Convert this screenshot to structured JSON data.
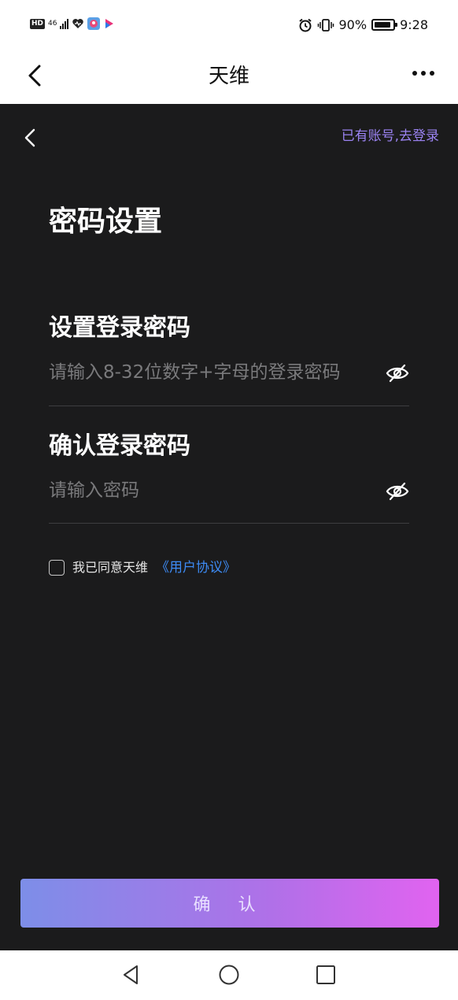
{
  "status_bar": {
    "hd": "HD",
    "network": "46",
    "battery": "90%",
    "battery_level": 0.9,
    "time": "9:28"
  },
  "title_bar": {
    "title": "天维"
  },
  "header": {
    "login_link": "已有账号,去登录"
  },
  "page_title": "密码设置",
  "fields": [
    {
      "label": "设置登录密码",
      "placeholder": "请输入8-32位数字+字母的登录密码",
      "value": ""
    },
    {
      "label": "确认登录密码",
      "placeholder": "请输入密码",
      "value": ""
    }
  ],
  "agreement": {
    "text": "我已同意天维",
    "link": "《用户协议》",
    "checked": false
  },
  "confirm_button": "确 认",
  "colors": {
    "background": "#1b1b1c",
    "link_purple": "#9b83f2",
    "link_blue": "#3d8bf5",
    "gradient_start": "#7d8ee8",
    "gradient_end": "#e163f0"
  }
}
